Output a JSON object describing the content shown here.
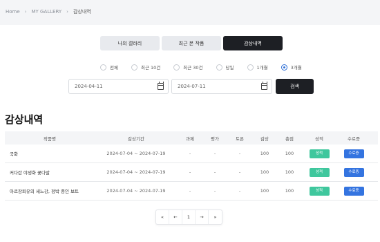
{
  "breadcrumb": {
    "items": [
      "Home",
      "MY GALLERY"
    ],
    "current": "감상내역",
    "separator": "›"
  },
  "tabs": [
    {
      "label": "나의 갤러리",
      "active": false
    },
    {
      "label": "최근 본 작품",
      "active": false
    },
    {
      "label": "감상내역",
      "active": true
    }
  ],
  "period_filter": {
    "options": [
      "전체",
      "최근 10건",
      "최근 30건",
      "당일",
      "1개월",
      "3개월"
    ],
    "selected": "3개월"
  },
  "date_range": {
    "start": "2024-04-11",
    "end": "2024-07-11"
  },
  "search_label": "검색",
  "page_title": "감상내역",
  "table": {
    "headers": [
      "작품명",
      "감상기간",
      "과제",
      "평가",
      "토론",
      "감상",
      "총점",
      "성적",
      "수료증"
    ],
    "rows": [
      {
        "title": "국화",
        "period": "2024-07-04 ~ 2024-07-19",
        "task": "-",
        "eval": "-",
        "discussion": "-",
        "view": "100",
        "total": "100",
        "grade": "성적",
        "cert": "수료증"
      },
      {
        "title": "커다란 야생화 꽃다발",
        "period": "2024-07-04 ~ 2024-07-19",
        "task": "-",
        "eval": "-",
        "discussion": "-",
        "view": "100",
        "total": "100",
        "grade": "성적",
        "cert": "수료증"
      },
      {
        "title": "아르장퇴유의 세느강, 정박 중인 보트",
        "period": "2024-07-04 ~ 2024-07-19",
        "task": "-",
        "eval": "-",
        "discussion": "-",
        "view": "100",
        "total": "100",
        "grade": "성적",
        "cert": "수료증"
      }
    ]
  },
  "pagination": {
    "first": "«",
    "prev": "←",
    "current": "1",
    "next": "→",
    "last": "»"
  },
  "colors": {
    "grade_badge": "#3fc79d",
    "cert_badge": "#3474e0",
    "active_tab": "#1d1f24",
    "radio_selected": "#2f6fd6"
  },
  "icons": {
    "date_picker": "calendar-icon"
  }
}
